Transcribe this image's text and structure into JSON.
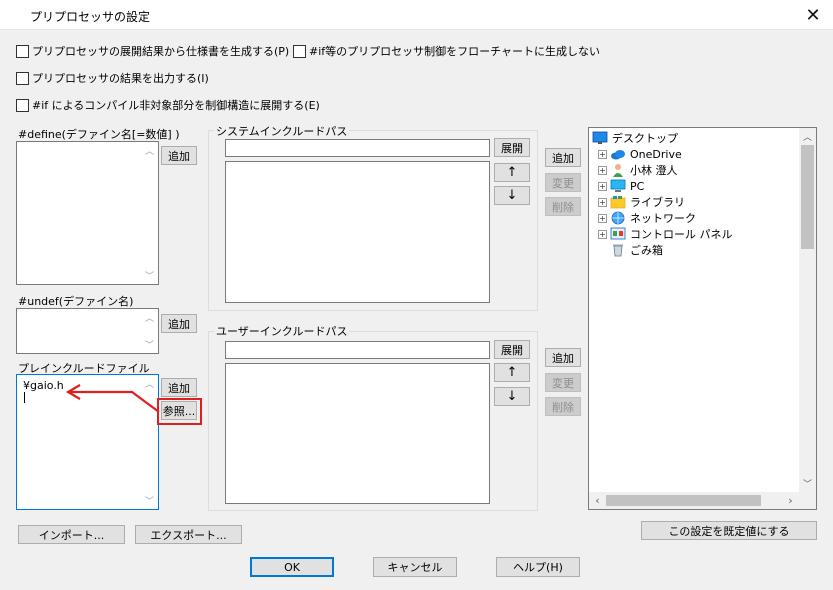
{
  "window": {
    "title": "プリプロセッサの設定",
    "close_glyph": "✕"
  },
  "options": {
    "gen_spec": "プリプロセッサの展開結果から仕様書を生成する(P)",
    "no_flowchart": "#if等のプリプロセッサ制御をフローチャートに生成しない",
    "output_result": "プリプロセッサの結果を出力する(I)",
    "expand_if": "#if によるコンパイル非対象部分を制御構造に展開する(E)"
  },
  "define": {
    "label": "#define(デファイン名[=数値] )",
    "add": "追加"
  },
  "undef": {
    "label": "#undef(デファイン名)",
    "add": "追加"
  },
  "preinclude": {
    "label": "プレインクルードファイル",
    "items": [
      "¥gaio.h"
    ],
    "add": "追加",
    "browse": "参照..."
  },
  "system_include": {
    "label": "システムインクルードパス",
    "expand": "展開",
    "up": "↑",
    "down": "↓",
    "add": "追加",
    "change": "変更",
    "delete": "削除"
  },
  "user_include": {
    "label": "ユーザーインクルードパス",
    "expand": "展開",
    "up": "↑",
    "down": "↓",
    "add": "追加",
    "change": "変更",
    "delete": "削除"
  },
  "tree": {
    "root": "デスクトップ",
    "items": [
      "OneDrive",
      "小林 澄人",
      "PC",
      "ライブラリ",
      "ネットワーク",
      "コントロール パネル",
      "ごみ箱"
    ],
    "icons": [
      "desktop-icon",
      "onedrive-icon",
      "user-icon",
      "pc-icon",
      "library-icon",
      "network-icon",
      "control-panel-icon",
      "recycle-bin-icon"
    ]
  },
  "buttons": {
    "import": "インポート...",
    "export": "エクスポート...",
    "set_default": "この設定を既定値にする",
    "ok": "OK",
    "cancel": "キャンセル",
    "help": "ヘルプ(H)"
  },
  "colors": {
    "accent": "#0078d7",
    "annotation": "#e02020"
  }
}
